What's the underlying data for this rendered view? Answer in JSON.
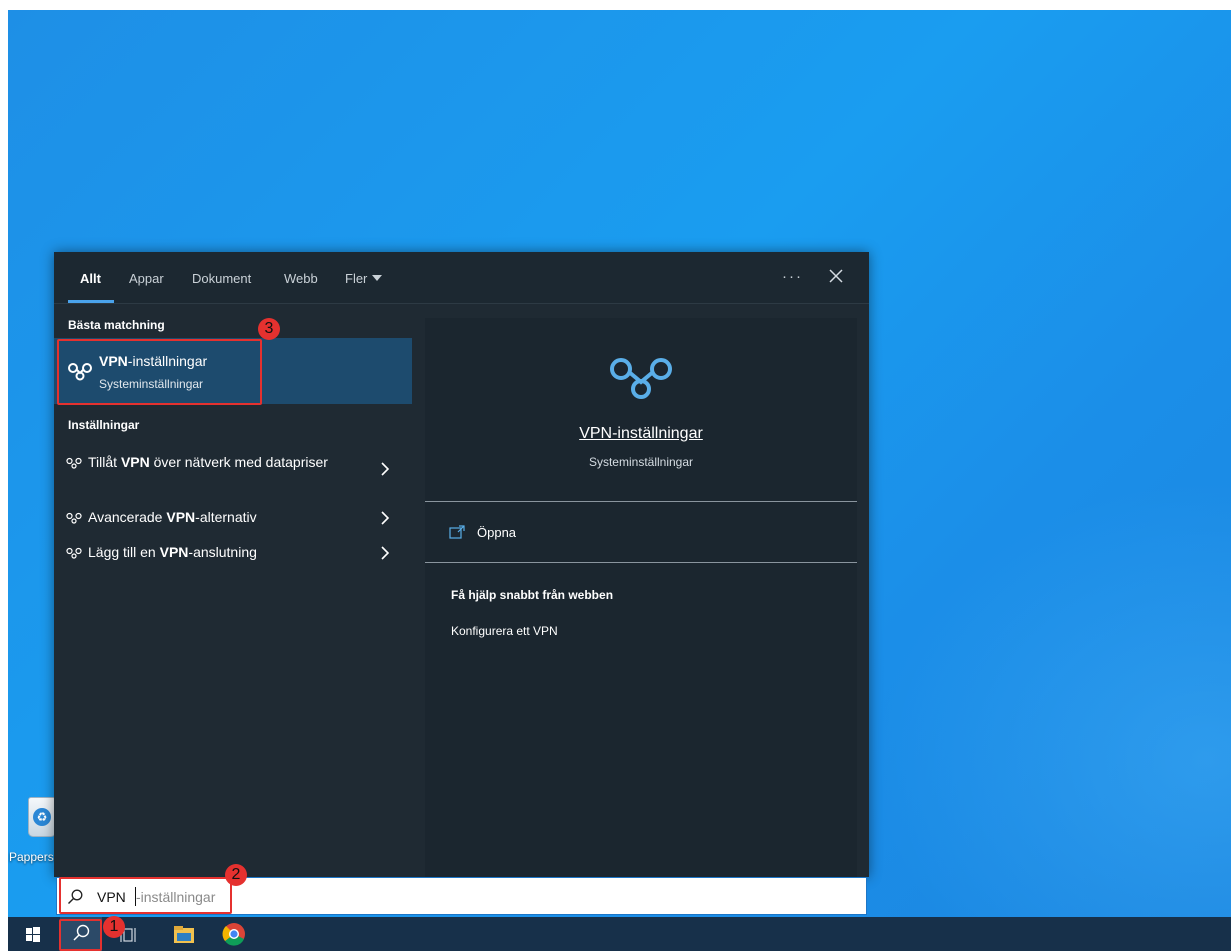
{
  "desktop": {
    "recycle_bin_label": "Pappers"
  },
  "panel": {
    "tabs": [
      {
        "label": "Allt"
      },
      {
        "label": "Appar"
      },
      {
        "label": "Dokument"
      },
      {
        "label": "Webb"
      },
      {
        "label": "Fler"
      }
    ],
    "more_options": "···",
    "left": {
      "best_match_title": "Bästa matchning",
      "best_match": {
        "title_bold": "VPN",
        "title_rest": "-inställningar",
        "subtitle": "Systeminställningar"
      },
      "settings_title": "Inställningar",
      "settings_items": [
        {
          "pre": "Tillåt ",
          "bold": "VPN",
          "post": " över nätverk med datapriser"
        },
        {
          "pre": "Avancerade ",
          "bold": "VPN",
          "post": "-alternativ"
        },
        {
          "pre": "Lägg till en ",
          "bold": "VPN",
          "post": "-anslutning"
        }
      ]
    },
    "right": {
      "title": "VPN-inställningar",
      "subtitle": "Systeminställningar",
      "open_label": "Öppna",
      "help_title": "Få hjälp snabbt från webben",
      "help_link": "Konfigurera ett VPN"
    }
  },
  "search": {
    "typed": "VPN",
    "suggestion": "-inställningar"
  },
  "annotations": {
    "step1": "1",
    "step2": "2",
    "step3": "3",
    "color": "#e5312f"
  },
  "colors": {
    "accent": "#4aa3ec",
    "selected_row": "#1d4b6e",
    "panel_bg": "#1f2a33",
    "taskbar": "#17304a"
  }
}
